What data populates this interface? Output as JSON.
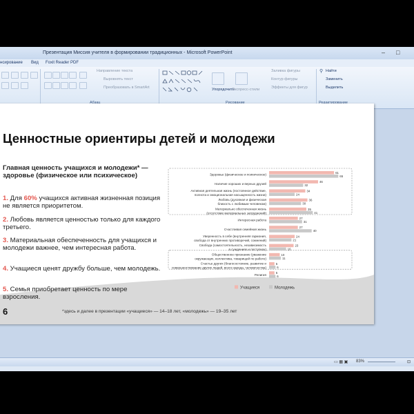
{
  "window": {
    "title": "Презентация Миссия учителя в формировании традиционных - Microsoft PowerPoint"
  },
  "menu": {
    "items": [
      "нсирование",
      "Вид",
      "Foxit Reader PDF"
    ]
  },
  "ribbon": {
    "paragraph_items": [
      "Направление текста",
      "Выровнять текст",
      "Преобразовать в SmartArt"
    ],
    "paragraph_label": "Абзац",
    "drawing_arrange": "Упорядочить",
    "drawing_styles": "Экспресс-стили",
    "drawing_items": [
      "Заливка фигуры",
      "Контур фигуры",
      "Эффекты для фигур"
    ],
    "drawing_label": "Рисование",
    "editing_items": [
      "Найти",
      "Заменить",
      "Выделить"
    ],
    "editing_label": "Редактирование"
  },
  "slide": {
    "title": "Ценностные ориентиры детей и молодежи",
    "subtitle": "Главная ценность учащихся и молодежи* — здоровье (физическое или психическое)",
    "points": [
      {
        "num": "1.",
        "pre": " Для ",
        "hl": "60%",
        "post": " учащихся активная жизненная позиция не является приоритетом."
      },
      {
        "num": "2.",
        "pre": " Любовь является ценностью только для каждого третьего.",
        "hl": "",
        "post": ""
      },
      {
        "num": "3.",
        "pre": " Материальная обеспеченность для учащихся и молодежи важнее, чем интересная работа.",
        "hl": "",
        "post": ""
      },
      {
        "num": "4.",
        "pre": " Учащиеся ценят дружбу больше, чем молодежь.",
        "hl": "",
        "post": ""
      },
      {
        "num": "5.",
        "pre": " Семья приобретает ценность по мере взросления.",
        "hl": "",
        "post": ""
      }
    ],
    "page_number": "6",
    "footnote": "*здесь и далее в презентации «учащиеся» — 14–18 лет, «молодежь» — 19–35 лет"
  },
  "chart_data": {
    "type": "bar",
    "orientation": "horizontal",
    "xlim": [
      0,
      70
    ],
    "categories": [
      [
        "Здоровье (физическое и психическое)"
      ],
      [
        "Наличие хороших и верных друзей"
      ],
      [
        "Активная деятельная жизнь (постоянное действие,",
        "полнота и эмоциональная насыщенность жизни)"
      ],
      [
        "Любовь (духовная и физическая",
        "близость с любимым человеком)"
      ],
      [
        "Материально обеспеченная жизнь",
        "(отсутствие материальных затруднений)"
      ],
      [
        "Интересная работа"
      ],
      [
        "Счастливая семейная жизнь"
      ],
      [
        "Уверенность в себе (внутренняя гармония,",
        "свобода от внутренних противоречий, сомнений)"
      ],
      [
        "Свобода (самостоятельность, независимость",
        "в суждениях и поступках)"
      ],
      [
        "Общественное признание (уважение",
        "окружающих, коллектива, товарищей по работе)"
      ],
      [
        "Счастье других (благосостояние, развитие и",
        "совершенствование других людей, всего народа, человечества)"
      ],
      [
        "Религия"
      ]
    ],
    "series": [
      {
        "name": "Учащиеся",
        "color": "#f2b8b0",
        "values": [
          61,
          46,
          34,
          36,
          35,
          27,
          27,
          24,
          23,
          10,
          5,
          5
        ]
      },
      {
        "name": "Молодежь",
        "color": "#c8c8c8",
        "values": [
          65,
          32,
          24,
          30,
          41,
          31,
          40,
          21,
          16,
          11,
          6,
          6
        ]
      }
    ],
    "highlight_groups": [
      [
        0,
        4
      ],
      [
        9,
        10
      ]
    ]
  },
  "status": {
    "zoom": "83%"
  }
}
